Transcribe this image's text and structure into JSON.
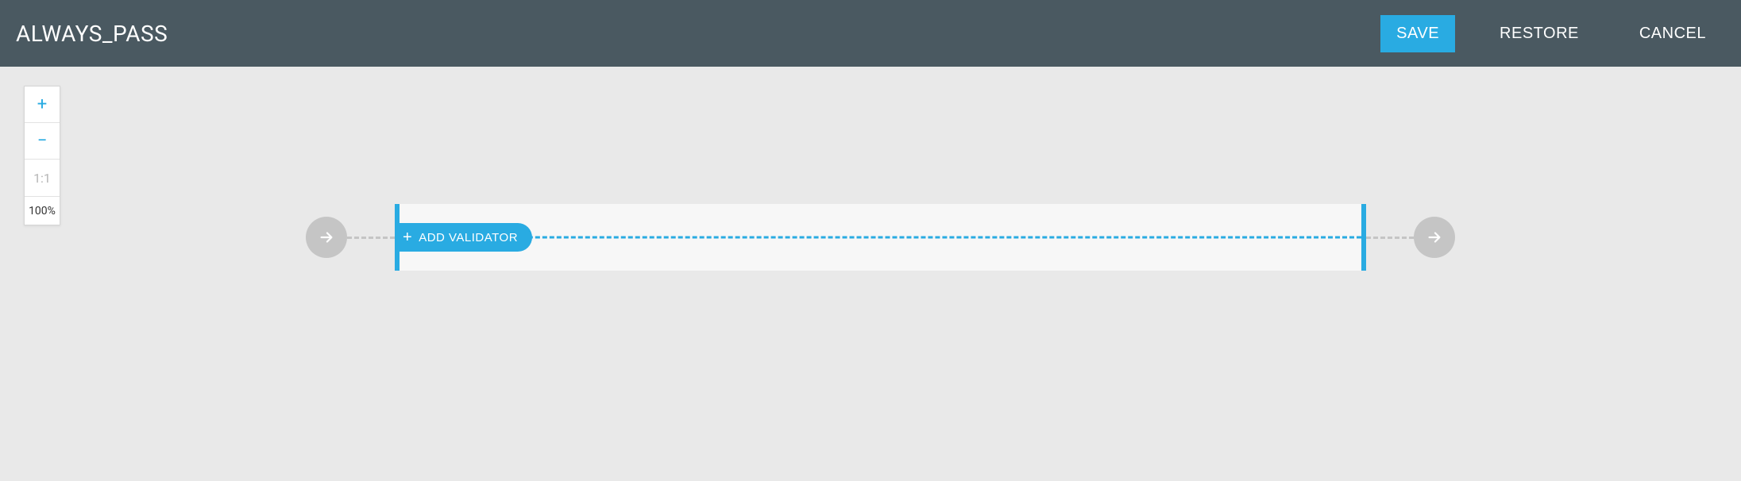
{
  "header": {
    "title": "ALWAYS_PASS",
    "save_label": "SAVE",
    "restore_label": "RESTORE",
    "cancel_label": "CANCEL"
  },
  "zoom": {
    "in_label": "+",
    "out_label": "−",
    "ratio_label": "1:1",
    "percent_label": "100%"
  },
  "flow": {
    "add_validator_label": "ADD VALIDATOR"
  },
  "colors": {
    "accent": "#29abe2",
    "header_bg": "#4a5961",
    "node_gray": "#c5c5c5"
  }
}
